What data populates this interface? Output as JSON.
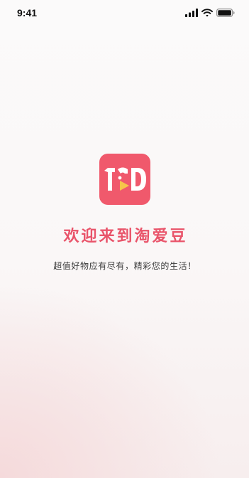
{
  "status_bar": {
    "time": "9:41",
    "icons": [
      "cellular-signal-icon",
      "wifi-icon",
      "battery-icon"
    ]
  },
  "logo": {
    "icon": "app-logo",
    "colors": {
      "background": "#f0596c",
      "glyph": "#ffffff",
      "play": "#f6c54a"
    }
  },
  "splash": {
    "title": "欢迎来到淘爱豆",
    "subtitle": "超值好物应有尽有，精彩您的生活！"
  },
  "colors": {
    "accent": "#e9546a",
    "text": "#3a3a3a",
    "background": "#faf7f7"
  }
}
